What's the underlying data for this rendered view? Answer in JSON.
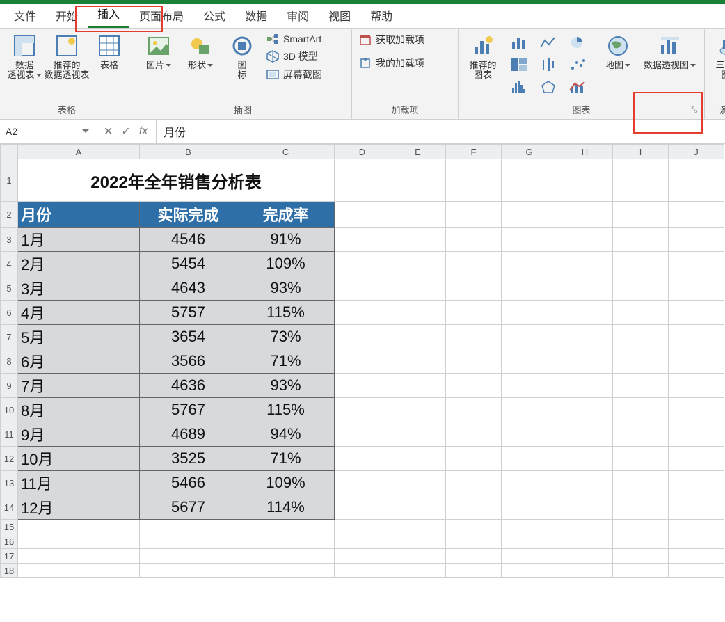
{
  "tabs": {
    "file": "文件",
    "home": "开始",
    "insert": "插入",
    "layout": "页面布局",
    "formula": "公式",
    "data": "数据",
    "review": "审阅",
    "view": "视图",
    "help": "帮助"
  },
  "ribbon": {
    "tables": {
      "pivot": "数据\n透视表",
      "recommend_pivot": "推荐的\n数据透视表",
      "table": "表格",
      "group_label": "表格"
    },
    "illustrations": {
      "picture": "图片",
      "shapes": "形状",
      "icons": "图\n标",
      "smartart": "SmartArt",
      "model3d": "3D 模型",
      "screenshot": "屏幕截图",
      "group_label": "插图"
    },
    "addins": {
      "get": "获取加载项",
      "mine": "我的加载项",
      "group_label": "加载项"
    },
    "charts": {
      "recommend": "推荐的\n图表",
      "map": "地图",
      "pivot_chart": "数据透视图",
      "three_d": "三维地\n图",
      "group_label": "图表",
      "demo_label": "演示"
    }
  },
  "formula_bar": {
    "cell_ref": "A2",
    "value": "月份"
  },
  "columns": [
    "A",
    "B",
    "C",
    "D",
    "E",
    "F",
    "G",
    "H",
    "I",
    "J"
  ],
  "sheet_title": "2022年全年销售分析表",
  "table_headers": {
    "month": "月份",
    "actual": "实际完成",
    "rate": "完成率"
  },
  "rows": [
    {
      "month": "1月",
      "actual": "4546",
      "rate": "91%"
    },
    {
      "month": "2月",
      "actual": "5454",
      "rate": "109%"
    },
    {
      "month": "3月",
      "actual": "4643",
      "rate": "93%"
    },
    {
      "month": "4月",
      "actual": "5757",
      "rate": "115%"
    },
    {
      "month": "5月",
      "actual": "3654",
      "rate": "73%"
    },
    {
      "month": "6月",
      "actual": "3566",
      "rate": "71%"
    },
    {
      "month": "7月",
      "actual": "4636",
      "rate": "93%"
    },
    {
      "month": "8月",
      "actual": "5767",
      "rate": "115%"
    },
    {
      "month": "9月",
      "actual": "4689",
      "rate": "94%"
    },
    {
      "month": "10月",
      "actual": "3525",
      "rate": "71%"
    },
    {
      "month": "11月",
      "actual": "5466",
      "rate": "109%"
    },
    {
      "month": "12月",
      "actual": "5677",
      "rate": "114%"
    }
  ],
  "chart_data": {
    "type": "table",
    "title": "2022年全年销售分析表",
    "categories": [
      "1月",
      "2月",
      "3月",
      "4月",
      "5月",
      "6月",
      "7月",
      "8月",
      "9月",
      "10月",
      "11月",
      "12月"
    ],
    "series": [
      {
        "name": "实际完成",
        "values": [
          4546,
          5454,
          4643,
          5757,
          3654,
          3566,
          4636,
          5767,
          4689,
          3525,
          5466,
          5677
        ]
      },
      {
        "name": "完成率",
        "values": [
          0.91,
          1.09,
          0.93,
          1.15,
          0.73,
          0.71,
          0.93,
          1.15,
          0.94,
          0.71,
          1.09,
          1.14
        ]
      }
    ]
  }
}
